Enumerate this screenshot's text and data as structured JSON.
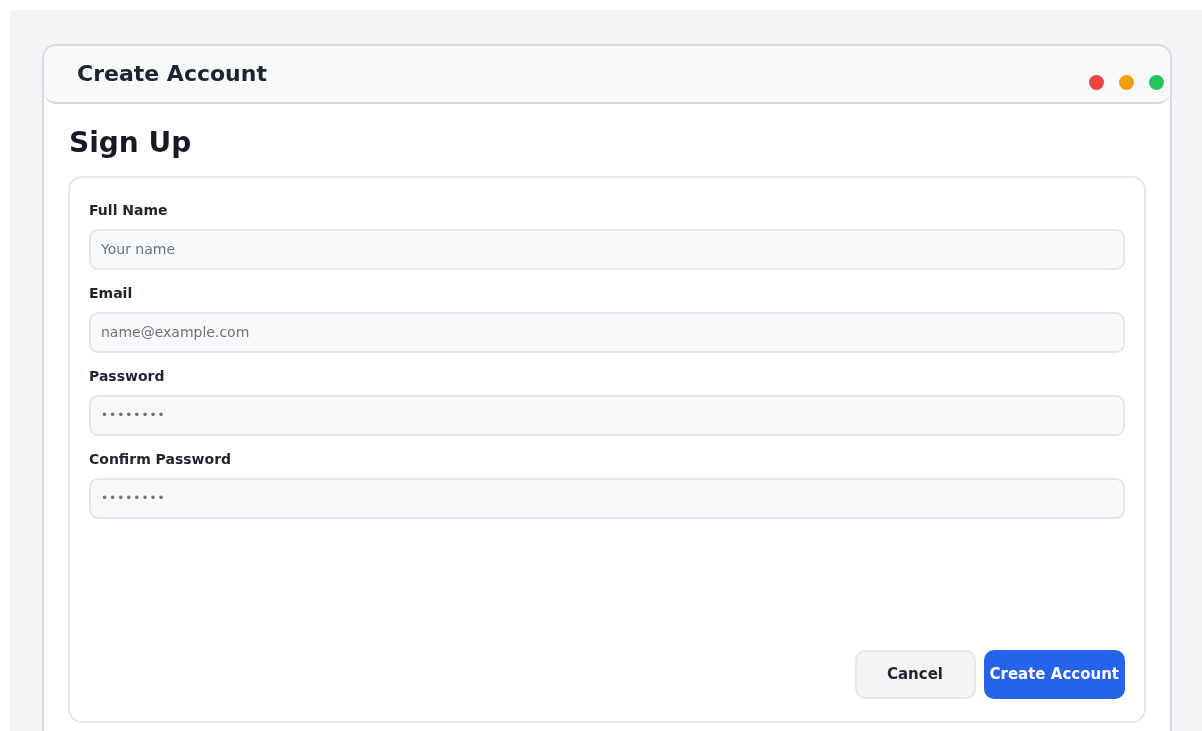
{
  "window": {
    "title": "Create Account",
    "controls": [
      {
        "color": "#ef4444"
      },
      {
        "color": "#f59e0b"
      },
      {
        "color": "#22c55e"
      }
    ]
  },
  "heading": "Sign Up",
  "fields": [
    {
      "label": "Full Name",
      "placeholder": "Your name"
    },
    {
      "label": "Email",
      "placeholder": "name@example.com"
    },
    {
      "label": "Password",
      "value": "••••••••"
    },
    {
      "label": "Confirm Password",
      "value": "••••••••"
    }
  ],
  "buttons": [
    {
      "label": "Cancel",
      "kind": "secondary"
    },
    {
      "label": "Create Account",
      "kind": "primary"
    }
  ]
}
